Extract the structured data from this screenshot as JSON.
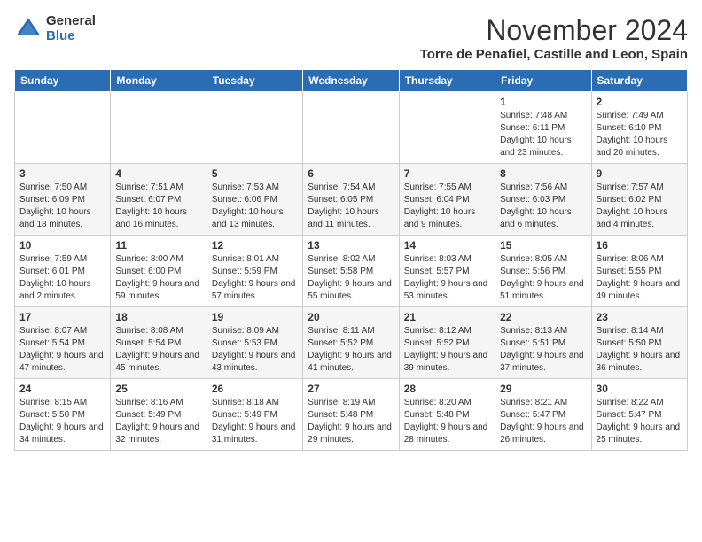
{
  "header": {
    "logo_general": "General",
    "logo_blue": "Blue",
    "month_title": "November 2024",
    "location": "Torre de Penafiel, Castille and Leon, Spain"
  },
  "days_of_week": [
    "Sunday",
    "Monday",
    "Tuesday",
    "Wednesday",
    "Thursday",
    "Friday",
    "Saturday"
  ],
  "weeks": [
    [
      {
        "day": "",
        "info": ""
      },
      {
        "day": "",
        "info": ""
      },
      {
        "day": "",
        "info": ""
      },
      {
        "day": "",
        "info": ""
      },
      {
        "day": "",
        "info": ""
      },
      {
        "day": "1",
        "info": "Sunrise: 7:48 AM\nSunset: 6:11 PM\nDaylight: 10 hours and 23 minutes."
      },
      {
        "day": "2",
        "info": "Sunrise: 7:49 AM\nSunset: 6:10 PM\nDaylight: 10 hours and 20 minutes."
      }
    ],
    [
      {
        "day": "3",
        "info": "Sunrise: 7:50 AM\nSunset: 6:09 PM\nDaylight: 10 hours and 18 minutes."
      },
      {
        "day": "4",
        "info": "Sunrise: 7:51 AM\nSunset: 6:07 PM\nDaylight: 10 hours and 16 minutes."
      },
      {
        "day": "5",
        "info": "Sunrise: 7:53 AM\nSunset: 6:06 PM\nDaylight: 10 hours and 13 minutes."
      },
      {
        "day": "6",
        "info": "Sunrise: 7:54 AM\nSunset: 6:05 PM\nDaylight: 10 hours and 11 minutes."
      },
      {
        "day": "7",
        "info": "Sunrise: 7:55 AM\nSunset: 6:04 PM\nDaylight: 10 hours and 9 minutes."
      },
      {
        "day": "8",
        "info": "Sunrise: 7:56 AM\nSunset: 6:03 PM\nDaylight: 10 hours and 6 minutes."
      },
      {
        "day": "9",
        "info": "Sunrise: 7:57 AM\nSunset: 6:02 PM\nDaylight: 10 hours and 4 minutes."
      }
    ],
    [
      {
        "day": "10",
        "info": "Sunrise: 7:59 AM\nSunset: 6:01 PM\nDaylight: 10 hours and 2 minutes."
      },
      {
        "day": "11",
        "info": "Sunrise: 8:00 AM\nSunset: 6:00 PM\nDaylight: 9 hours and 59 minutes."
      },
      {
        "day": "12",
        "info": "Sunrise: 8:01 AM\nSunset: 5:59 PM\nDaylight: 9 hours and 57 minutes."
      },
      {
        "day": "13",
        "info": "Sunrise: 8:02 AM\nSunset: 5:58 PM\nDaylight: 9 hours and 55 minutes."
      },
      {
        "day": "14",
        "info": "Sunrise: 8:03 AM\nSunset: 5:57 PM\nDaylight: 9 hours and 53 minutes."
      },
      {
        "day": "15",
        "info": "Sunrise: 8:05 AM\nSunset: 5:56 PM\nDaylight: 9 hours and 51 minutes."
      },
      {
        "day": "16",
        "info": "Sunrise: 8:06 AM\nSunset: 5:55 PM\nDaylight: 9 hours and 49 minutes."
      }
    ],
    [
      {
        "day": "17",
        "info": "Sunrise: 8:07 AM\nSunset: 5:54 PM\nDaylight: 9 hours and 47 minutes."
      },
      {
        "day": "18",
        "info": "Sunrise: 8:08 AM\nSunset: 5:54 PM\nDaylight: 9 hours and 45 minutes."
      },
      {
        "day": "19",
        "info": "Sunrise: 8:09 AM\nSunset: 5:53 PM\nDaylight: 9 hours and 43 minutes."
      },
      {
        "day": "20",
        "info": "Sunrise: 8:11 AM\nSunset: 5:52 PM\nDaylight: 9 hours and 41 minutes."
      },
      {
        "day": "21",
        "info": "Sunrise: 8:12 AM\nSunset: 5:52 PM\nDaylight: 9 hours and 39 minutes."
      },
      {
        "day": "22",
        "info": "Sunrise: 8:13 AM\nSunset: 5:51 PM\nDaylight: 9 hours and 37 minutes."
      },
      {
        "day": "23",
        "info": "Sunrise: 8:14 AM\nSunset: 5:50 PM\nDaylight: 9 hours and 36 minutes."
      }
    ],
    [
      {
        "day": "24",
        "info": "Sunrise: 8:15 AM\nSunset: 5:50 PM\nDaylight: 9 hours and 34 minutes."
      },
      {
        "day": "25",
        "info": "Sunrise: 8:16 AM\nSunset: 5:49 PM\nDaylight: 9 hours and 32 minutes."
      },
      {
        "day": "26",
        "info": "Sunrise: 8:18 AM\nSunset: 5:49 PM\nDaylight: 9 hours and 31 minutes."
      },
      {
        "day": "27",
        "info": "Sunrise: 8:19 AM\nSunset: 5:48 PM\nDaylight: 9 hours and 29 minutes."
      },
      {
        "day": "28",
        "info": "Sunrise: 8:20 AM\nSunset: 5:48 PM\nDaylight: 9 hours and 28 minutes."
      },
      {
        "day": "29",
        "info": "Sunrise: 8:21 AM\nSunset: 5:47 PM\nDaylight: 9 hours and 26 minutes."
      },
      {
        "day": "30",
        "info": "Sunrise: 8:22 AM\nSunset: 5:47 PM\nDaylight: 9 hours and 25 minutes."
      }
    ]
  ]
}
